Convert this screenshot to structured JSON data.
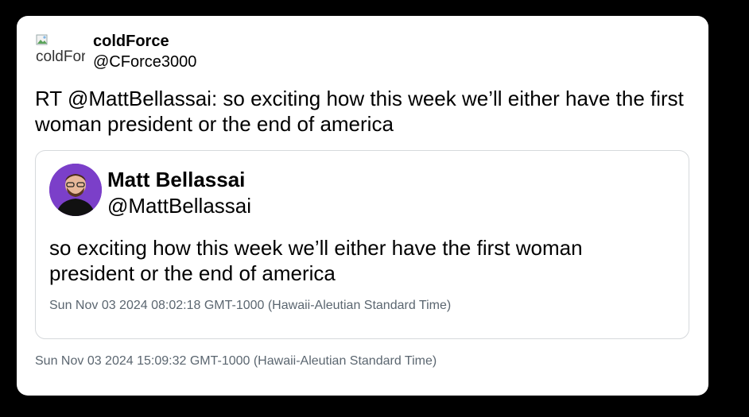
{
  "tweet": {
    "author": {
      "avatar_alt": "coldForce",
      "display_name": "coldForce",
      "handle": "@CForce3000"
    },
    "text": "RT @MattBellassai: so exciting how this week we’ll either have the first woman president or the end of america",
    "timestamp": "Sun Nov 03 2024 15:09:32 GMT-1000 (Hawaii-Aleutian Standard Time)"
  },
  "quoted_tweet": {
    "author": {
      "display_name": "Matt Bellassai",
      "handle": "@MattBellassai"
    },
    "text": "so exciting how this week we’ll either have the first woman president or the end of america",
    "timestamp": "Sun Nov 03 2024 08:02:18 GMT-1000 (Hawaii-Aleutian Standard Time)"
  },
  "colors": {
    "background": "#000000",
    "card": "#ffffff",
    "border": "#d6d9dc",
    "timestamp": "#5b6670",
    "avatar_bg": "#7b3fc9"
  }
}
